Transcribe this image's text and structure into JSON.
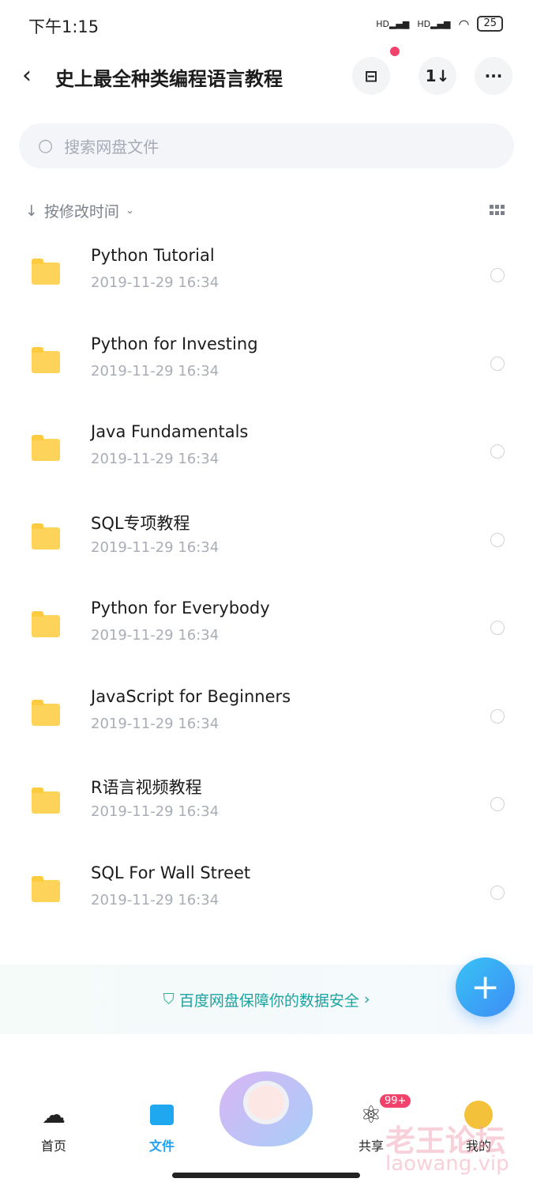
{
  "status": {
    "time": "下午1:15",
    "battery": "25"
  },
  "header": {
    "title": "史上最全种类编程语言教程"
  },
  "search": {
    "placeholder": "搜索网盘文件"
  },
  "sort": {
    "label": "按修改时间"
  },
  "files": [
    {
      "name": "Python Tutorial",
      "date": "2019-11-29  16:34"
    },
    {
      "name": "Python for Investing",
      "date": "2019-11-29  16:34"
    },
    {
      "name": "Java Fundamentals",
      "date": "2019-11-29  16:34"
    },
    {
      "name": "SQL专项教程",
      "date": "2019-11-29  16:34"
    },
    {
      "name": "Python for Everybody",
      "date": "2019-11-29  16:34"
    },
    {
      "name": "JavaScript for Beginners",
      "date": "2019-11-29  16:34"
    },
    {
      "name": "R语言视频教程",
      "date": "2019-11-29  16:34"
    },
    {
      "name": "SQL For Wall Street",
      "date": "2019-11-29  16:34"
    }
  ],
  "banner": {
    "text": "百度网盘保障你的数据安全"
  },
  "nav": {
    "home": "首页",
    "files": "文件",
    "share": "共享",
    "share_badge": "99+",
    "me": "我的"
  },
  "watermark": {
    "line1": "老王论坛",
    "line2": "laowang.vip"
  },
  "colors": {
    "accent": "#1fa0f0",
    "folder": "#fdd35a",
    "badge": "#f0426b"
  }
}
